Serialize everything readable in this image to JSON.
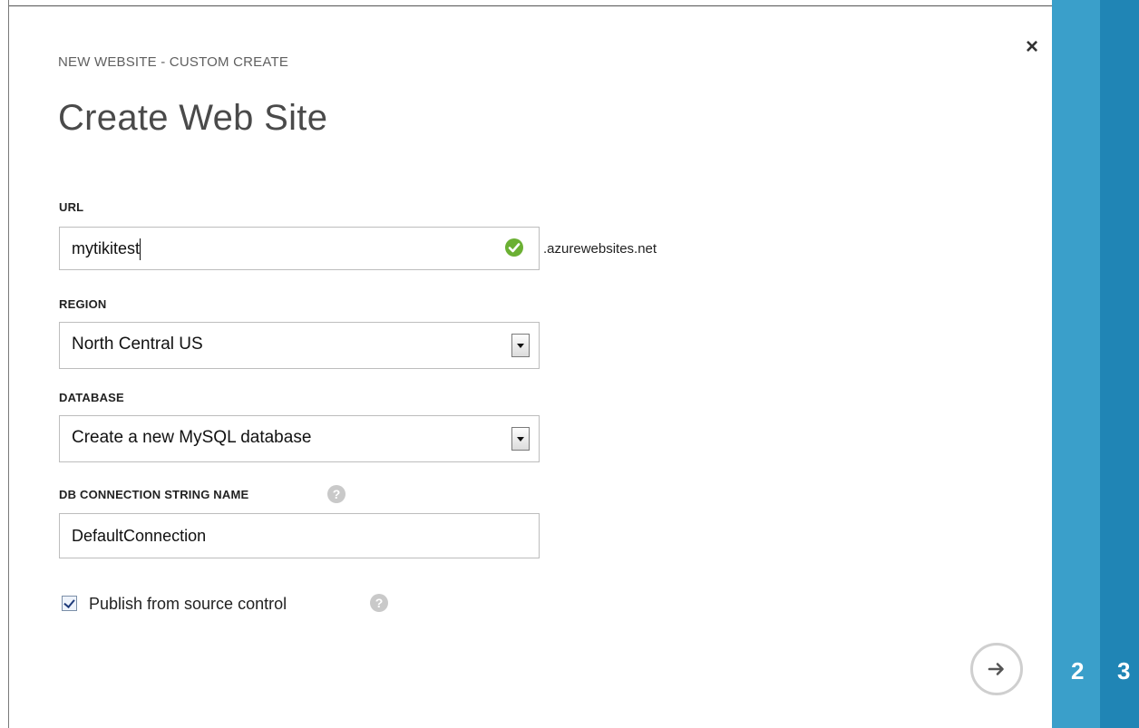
{
  "dialog": {
    "subtitle": "NEW WEBSITE - CUSTOM CREATE",
    "title": "Create Web Site",
    "close_label": "×"
  },
  "url": {
    "label": "URL",
    "value": "mytikitest",
    "suffix": ".azurewebsites.net",
    "validation_icon": "check-circle-icon",
    "validation_color": "#6bb033"
  },
  "region": {
    "label": "REGION",
    "selected": "North Central US"
  },
  "database": {
    "label": "DATABASE",
    "selected": "Create a new MySQL database"
  },
  "db_connection": {
    "label": "DB CONNECTION STRING NAME",
    "value": "DefaultConnection",
    "help_icon": "question-mark-icon"
  },
  "publish": {
    "label": "Publish from source control",
    "checked": true,
    "help_icon": "question-mark-icon"
  },
  "next_button": {
    "icon": "arrow-right-icon"
  },
  "wizard": {
    "steps": [
      {
        "number": "2",
        "color": "#3a9fca"
      },
      {
        "number": "3",
        "color": "#2085b5"
      }
    ]
  },
  "colors": {
    "accent": "#3a9fca",
    "accent_dark": "#2085b5",
    "help_gray": "#c9c9c9"
  }
}
